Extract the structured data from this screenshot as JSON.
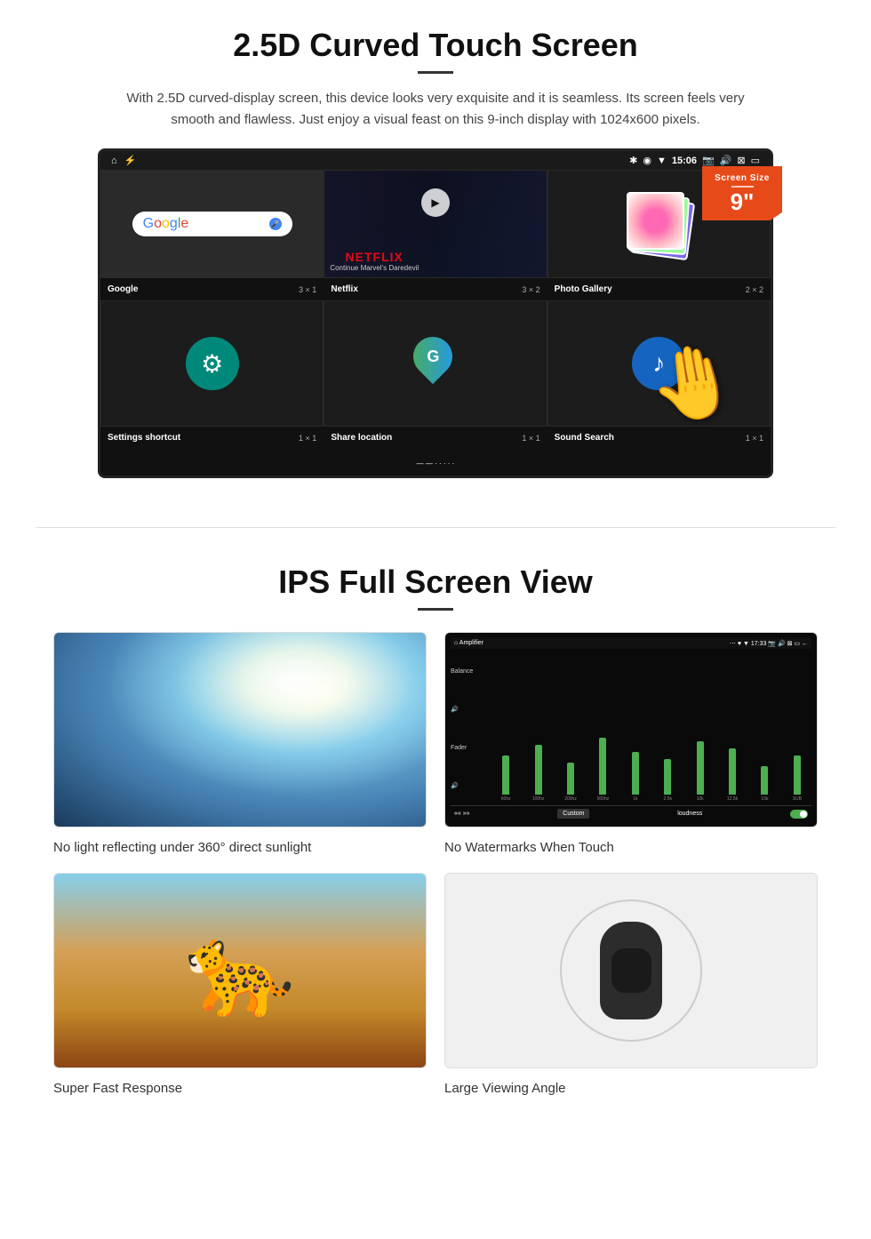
{
  "section1": {
    "title": "2.5D Curved Touch Screen",
    "description": "With 2.5D curved-display screen, this device looks very exquisite and it is seamless. Its screen feels very smooth and flawless. Just enjoy a visual feast on this 9-inch display with 1024x600 pixels.",
    "badge": {
      "label": "Screen Size",
      "size": "9\""
    },
    "device": {
      "statusBar": {
        "time": "15:06",
        "icons": [
          "bluetooth",
          "location",
          "wifi",
          "camera",
          "volume",
          "close",
          "square"
        ]
      },
      "apps": [
        {
          "name": "Google",
          "size": "3 × 1"
        },
        {
          "name": "Netflix",
          "size": "3 × 2"
        },
        {
          "name": "Photo Gallery",
          "size": "2 × 2"
        },
        {
          "name": "Settings shortcut",
          "size": "1 × 1"
        },
        {
          "name": "Share location",
          "size": "1 × 1"
        },
        {
          "name": "Sound Search",
          "size": "1 × 1"
        }
      ],
      "netflix": {
        "logo": "NETFLIX",
        "subtitle": "Continue Marvel's Daredevil"
      }
    }
  },
  "section2": {
    "title": "IPS Full Screen View",
    "features": [
      {
        "label": "No light reflecting under 360° direct sunlight"
      },
      {
        "label": "No Watermarks When Touch"
      },
      {
        "label": "Super Fast Response"
      },
      {
        "label": "Large Viewing Angle"
      }
    ]
  },
  "equalizer": {
    "bars": [
      55,
      70,
      45,
      80,
      60,
      50,
      75,
      65,
      40,
      55
    ],
    "labels": [
      "60hz",
      "100hz",
      "200hz",
      "500hz",
      "1k",
      "2.5k",
      "10k",
      "12.5k",
      "15k",
      "SUB"
    ]
  }
}
